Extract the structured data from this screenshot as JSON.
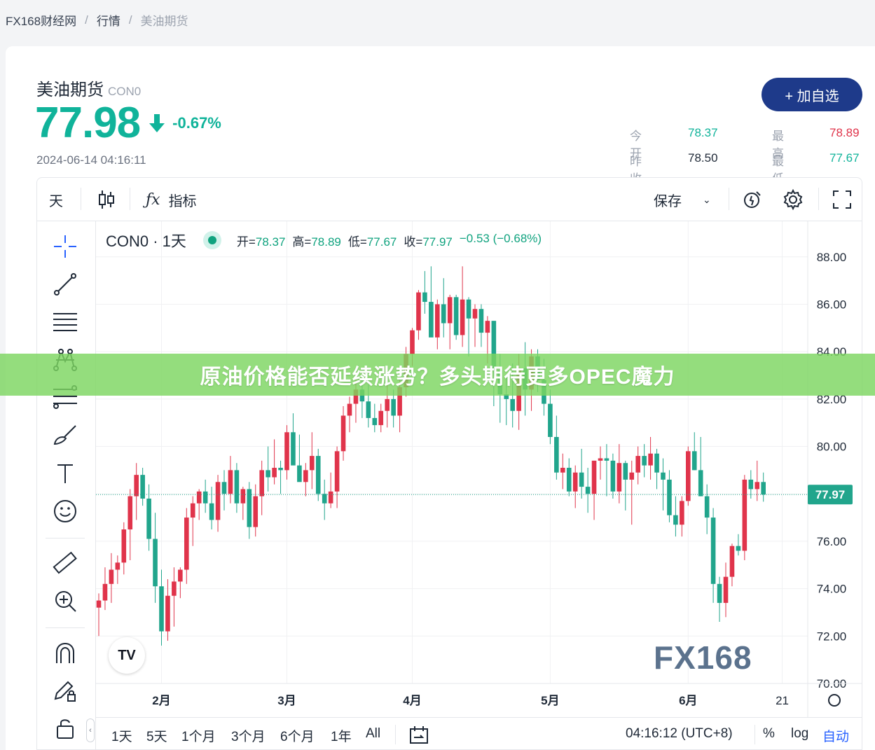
{
  "breadcrumb": [
    "FX168财经网",
    "行情",
    "美油期货"
  ],
  "header": {
    "title": "美油期货",
    "code": "CON0",
    "price": "77.98",
    "change_pct": "-0.67%",
    "timestamp": "2024-06-14 04:16:11",
    "add_button": "+ 加自选"
  },
  "stats": {
    "open_label": "今开",
    "open": "78.37",
    "high_label": "最高",
    "high": "78.89",
    "prev_close_label": "昨收",
    "prev_close": "78.50",
    "low_label": "最低",
    "low": "77.67"
  },
  "toolbar": {
    "interval": "天",
    "indicators": "指标",
    "save": "保存"
  },
  "legend": {
    "title": "CON0 · 1天",
    "open": "开=",
    "open_val": "78.37",
    "high": "高=",
    "high_val": "78.89",
    "low": "低=",
    "low_val": "77.67",
    "close": "收=",
    "close_val": "77.97",
    "change": "−0.53 (−0.68%)"
  },
  "bottom": {
    "ranges": [
      "1天",
      "5天",
      "1个月",
      "3个月",
      "6个月",
      "1年",
      "All"
    ],
    "time": "04:16:12 (UTC+8)",
    "pct": "%",
    "log": "log",
    "auto": "自动"
  },
  "banner": "原油价格能否延续涨势？多头期待更多OPEC魔力",
  "watermark": "FX168",
  "colors": {
    "up": "#e0344b",
    "down": "#21a58c",
    "accent": "#1e3a8a",
    "price": "#10b39a"
  },
  "chart_data": {
    "type": "candlestick",
    "ylim": [
      70,
      89.5
    ],
    "yticks": [
      "88.00",
      "86.00",
      "84.00",
      "82.00",
      "80.00",
      "78.00",
      "76.00",
      "74.00",
      "72.00",
      "70.00"
    ],
    "xticks": [
      "2月",
      "3月",
      "4月",
      "5月",
      "6月",
      "21"
    ],
    "last_price_label": "77.97",
    "last_price": 77.97,
    "candles": [
      [
        73.2,
        73.8,
        72.0,
        73.5
      ],
      [
        73.5,
        74.9,
        73.1,
        74.2
      ],
      [
        74.2,
        75.5,
        73.4,
        74.8
      ],
      [
        74.8,
        75.4,
        74.2,
        75.1
      ],
      [
        75.1,
        76.8,
        74.6,
        76.5
      ],
      [
        76.5,
        78.2,
        75.2,
        77.9
      ],
      [
        77.9,
        79.3,
        76.9,
        78.8
      ],
      [
        78.8,
        79.1,
        77.5,
        77.8
      ],
      [
        77.8,
        78.4,
        75.6,
        76.1
      ],
      [
        76.1,
        77.2,
        73.4,
        74.1
      ],
      [
        74.1,
        74.8,
        71.6,
        72.2
      ],
      [
        72.2,
        74.4,
        71.8,
        73.7
      ],
      [
        73.7,
        74.9,
        72.4,
        74.3
      ],
      [
        74.3,
        74.9,
        73.6,
        74.8
      ],
      [
        74.8,
        77.4,
        74.2,
        77.0
      ],
      [
        77.0,
        77.9,
        75.8,
        77.6
      ],
      [
        77.6,
        78.2,
        76.9,
        78.1
      ],
      [
        78.1,
        78.6,
        77.2,
        77.6
      ],
      [
        77.6,
        78.3,
        76.5,
        76.9
      ],
      [
        76.9,
        78.8,
        76.4,
        78.5
      ],
      [
        78.5,
        79.0,
        77.3,
        78.0
      ],
      [
        78.0,
        79.6,
        77.6,
        79.0
      ],
      [
        79.0,
        79.3,
        77.2,
        77.6
      ],
      [
        77.6,
        78.3,
        76.9,
        78.2
      ],
      [
        78.2,
        78.5,
        76.1,
        76.6
      ],
      [
        76.6,
        78.4,
        76.2,
        77.9
      ],
      [
        77.9,
        79.4,
        77.1,
        79.0
      ],
      [
        79.0,
        80.0,
        78.1,
        78.7
      ],
      [
        78.7,
        80.3,
        78.4,
        79.1
      ],
      [
        79.1,
        79.4,
        78.0,
        79.0
      ],
      [
        79.0,
        80.9,
        78.6,
        80.6
      ],
      [
        80.6,
        81.4,
        79.5,
        79.2
      ],
      [
        79.2,
        80.5,
        78.6,
        78.5
      ],
      [
        78.5,
        79.3,
        77.9,
        79.0
      ],
      [
        79.0,
        80.6,
        78.2,
        79.6
      ],
      [
        79.6,
        79.9,
        77.7,
        78.0
      ],
      [
        78.0,
        78.6,
        76.9,
        77.6
      ],
      [
        77.6,
        78.9,
        77.4,
        78.1
      ],
      [
        78.1,
        80.0,
        77.4,
        79.8
      ],
      [
        79.8,
        81.7,
        79.4,
        81.3
      ],
      [
        81.3,
        82.1,
        80.6,
        81.8
      ],
      [
        81.8,
        83.2,
        81.0,
        82.4
      ],
      [
        82.4,
        82.9,
        81.2,
        81.9
      ],
      [
        81.9,
        82.6,
        80.8,
        81.2
      ],
      [
        81.2,
        81.8,
        80.6,
        80.9
      ],
      [
        80.9,
        81.8,
        80.6,
        81.5
      ],
      [
        81.5,
        82.6,
        80.8,
        82.0
      ],
      [
        82.0,
        82.4,
        80.8,
        81.3
      ],
      [
        81.3,
        82.8,
        80.6,
        82.5
      ],
      [
        82.5,
        84.2,
        82.1,
        83.9
      ],
      [
        83.9,
        85.0,
        83.4,
        84.9
      ],
      [
        84.9,
        86.6,
        84.5,
        86.5
      ],
      [
        86.5,
        87.4,
        85.6,
        86.1
      ],
      [
        86.1,
        87.6,
        84.9,
        84.6
      ],
      [
        84.6,
        86.2,
        84.1,
        86.0
      ],
      [
        86.0,
        87.1,
        84.6,
        85.2
      ],
      [
        85.2,
        86.4,
        84.1,
        86.3
      ],
      [
        86.3,
        86.4,
        84.5,
        84.7
      ],
      [
        84.7,
        87.6,
        84.2,
        86.2
      ],
      [
        86.2,
        86.3,
        83.8,
        85.4
      ],
      [
        85.4,
        86.0,
        84.2,
        85.8
      ],
      [
        85.8,
        86.0,
        84.2,
        84.8
      ],
      [
        84.8,
        85.5,
        83.5,
        85.3
      ],
      [
        85.3,
        85.3,
        81.7,
        83.2
      ],
      [
        83.2,
        83.9,
        81.0,
        82.2
      ],
      [
        82.2,
        82.9,
        80.9,
        82.0
      ],
      [
        82.0,
        83.5,
        80.8,
        81.5
      ],
      [
        81.5,
        83.9,
        80.7,
        83.3
      ],
      [
        83.3,
        84.4,
        81.3,
        82.4
      ],
      [
        82.4,
        84.1,
        81.5,
        83.8
      ],
      [
        83.8,
        84.1,
        82.3,
        82.8
      ],
      [
        82.8,
        83.7,
        81.3,
        81.8
      ],
      [
        81.8,
        82.4,
        80.1,
        80.4
      ],
      [
        80.4,
        81.3,
        78.6,
        78.9
      ],
      [
        78.9,
        79.7,
        78.2,
        79.1
      ],
      [
        79.1,
        79.5,
        77.9,
        78.1
      ],
      [
        78.1,
        79.2,
        77.4,
        78.9
      ],
      [
        78.9,
        79.9,
        77.8,
        78.3
      ],
      [
        78.3,
        79.1,
        77.2,
        78.0
      ],
      [
        78.0,
        79.4,
        76.9,
        79.4
      ],
      [
        79.4,
        80.0,
        78.6,
        79.5
      ],
      [
        79.5,
        80.1,
        77.9,
        79.4
      ],
      [
        79.4,
        79.7,
        77.8,
        78.1
      ],
      [
        78.1,
        80.1,
        77.6,
        79.3
      ],
      [
        79.3,
        79.4,
        77.3,
        78.6
      ],
      [
        78.6,
        79.4,
        76.7,
        78.9
      ],
      [
        78.9,
        80.0,
        78.4,
        79.6
      ],
      [
        79.6,
        80.1,
        78.7,
        79.2
      ],
      [
        79.2,
        80.4,
        78.6,
        79.7
      ],
      [
        79.7,
        79.9,
        78.2,
        78.9
      ],
      [
        78.9,
        79.5,
        77.3,
        78.6
      ],
      [
        78.6,
        79.0,
        76.8,
        77.1
      ],
      [
        77.1,
        77.9,
        76.2,
        76.7
      ],
      [
        76.7,
        77.9,
        76.2,
        77.7
      ],
      [
        77.7,
        80.0,
        77.5,
        79.8
      ],
      [
        79.8,
        80.6,
        79.0,
        79.0
      ],
      [
        79.0,
        80.4,
        77.9,
        77.9
      ],
      [
        77.9,
        78.4,
        76.3,
        77.0
      ],
      [
        77.0,
        77.4,
        73.4,
        74.2
      ],
      [
        74.2,
        74.5,
        72.6,
        73.4
      ],
      [
        73.4,
        75.1,
        72.8,
        74.5
      ],
      [
        74.5,
        75.9,
        74.1,
        75.8
      ],
      [
        75.8,
        76.3,
        75.4,
        75.6
      ],
      [
        75.6,
        78.8,
        75.2,
        78.6
      ],
      [
        78.6,
        79.0,
        77.8,
        78.2
      ],
      [
        78.2,
        79.4,
        77.7,
        78.5
      ],
      [
        78.5,
        78.9,
        77.67,
        77.97
      ]
    ]
  }
}
